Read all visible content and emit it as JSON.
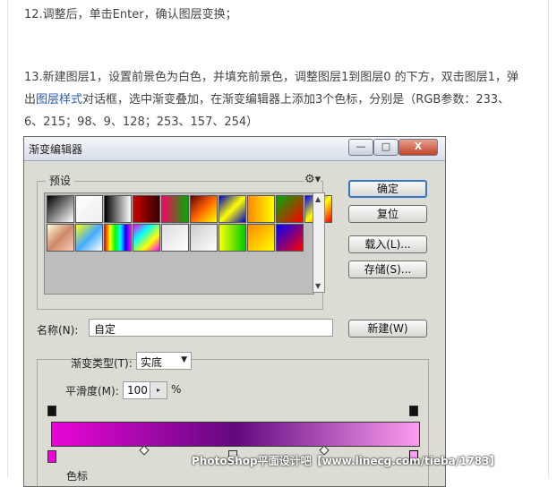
{
  "article": {
    "step12": "12.调整后，单击Enter，确认图层变换；",
    "step13_pre": "13.新建图层1，设置前景色为白色，并填充前景色，调整图层1到图层0 的下方，双击图层1，弹出",
    "step13_link": "图层样式",
    "step13_post": "对话框，选中渐变叠加，在渐变编辑器上添加3个色标，分别是（RGB参数：233、6、215；98、9、128；253、157、254）"
  },
  "dialog": {
    "title": "渐变编辑器",
    "buttons": {
      "min": "—",
      "max": "□",
      "close": "X",
      "ok": "确定",
      "reset": "复位",
      "load": "载入(L)...",
      "save": "存储(S)...",
      "new": "新建(W)"
    },
    "presets_label": "预设",
    "gear_icon": "gear-icon",
    "name_label": "名称(N):",
    "name_value": "自定",
    "gradient_type_label": "渐变类型(T):",
    "gradient_type_value": "实底",
    "smoothness_label": "平滑度(M):",
    "smoothness_value": "100",
    "smoothness_unit": "%",
    "color_stops_label": "色标",
    "gradient_colors": [
      "#e906d7",
      "#62097f",
      "#fd9df0"
    ]
  },
  "presets": [
    "linear-gradient(135deg,#000,#fff)",
    "linear-gradient(135deg,#fff,#eee)",
    "linear-gradient(to right,#000,#fff)",
    "linear-gradient(to right,#c00,#300)",
    "linear-gradient(to right,#f06,#0a0)",
    "linear-gradient(135deg,#600,#f60,#ff0)",
    "linear-gradient(135deg,#00c,#ff0,#00c)",
    "linear-gradient(to right,#f80,#ff0)",
    "linear-gradient(135deg,#0a0,#f00)",
    "linear-gradient(135deg,#00f,#ff0,#f00)",
    "linear-gradient(135deg,#ffd,#c86,#fcb)",
    "linear-gradient(135deg,#ff0,#4af,#fff)",
    "linear-gradient(to right,#f00,#ff0,#0f0,#0ff,#00f,#f0f)",
    "linear-gradient(135deg,#f0f,#0ff,#ff0,#f0f)",
    "linear-gradient(135deg,#ddd,#fff)",
    "linear-gradient(135deg,#ccc,#fff)",
    "linear-gradient(to right,#ff0,#0c0)",
    "linear-gradient(135deg,#f80,#ff0)",
    "linear-gradient(135deg,#00f,#f00)"
  ],
  "watermark": "PhotoShop平面设计吧【www.linecg.com/tieba/1783】"
}
